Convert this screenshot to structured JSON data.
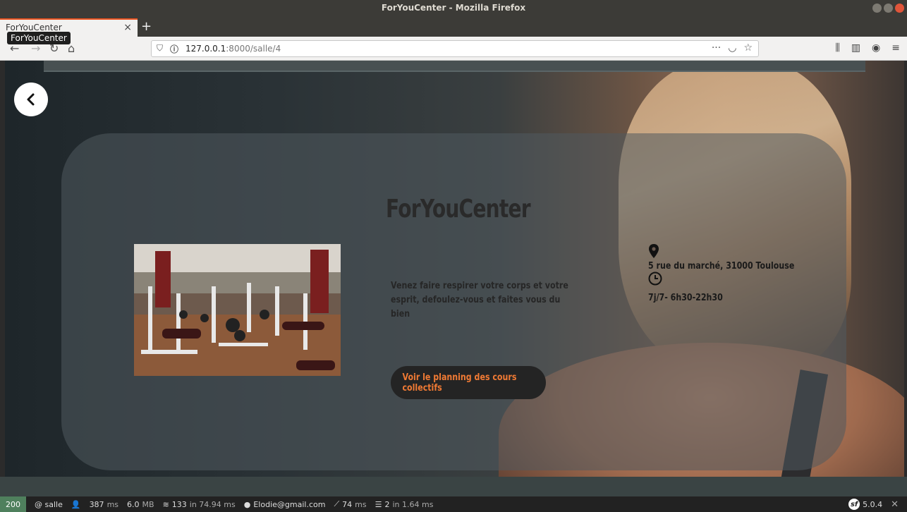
{
  "window": {
    "title": "ForYouCenter - Mozilla Firefox"
  },
  "tab": {
    "label": "ForYouCenter",
    "close_glyph": "×",
    "new_tab_glyph": "+"
  },
  "tooltip": {
    "text": "ForYouCenter"
  },
  "urlbar": {
    "host": "127.0.0.1",
    "rest": ":8000/salle/4",
    "more_glyph": "···"
  },
  "page": {
    "title": "ForYouCenter",
    "description": "Venez faire respirer votre corps et votre esprit, defoulez-vous et faites vous du bien",
    "cta_label": "Voir le planning des cours collectifs",
    "address": "5 rue du marché, 31000 Toulouse",
    "hours": "7j/7- 6h30-22h30",
    "colors": {
      "cta_text": "#f07a34",
      "cta_bg": "#242424"
    }
  },
  "symfony": {
    "status": "200",
    "route": "@ salle",
    "time": "387",
    "time_unit": "ms",
    "memory": "6.0",
    "memory_unit": "MB",
    "cache_calls": "133",
    "cache_in": "in 74.94 ms",
    "user": "Elodie@gmail.com",
    "twig": "74",
    "twig_unit": "ms",
    "db_queries": "2",
    "db_in": "in 1.64 ms",
    "version": "5.0.4",
    "close_glyph": "✕"
  }
}
